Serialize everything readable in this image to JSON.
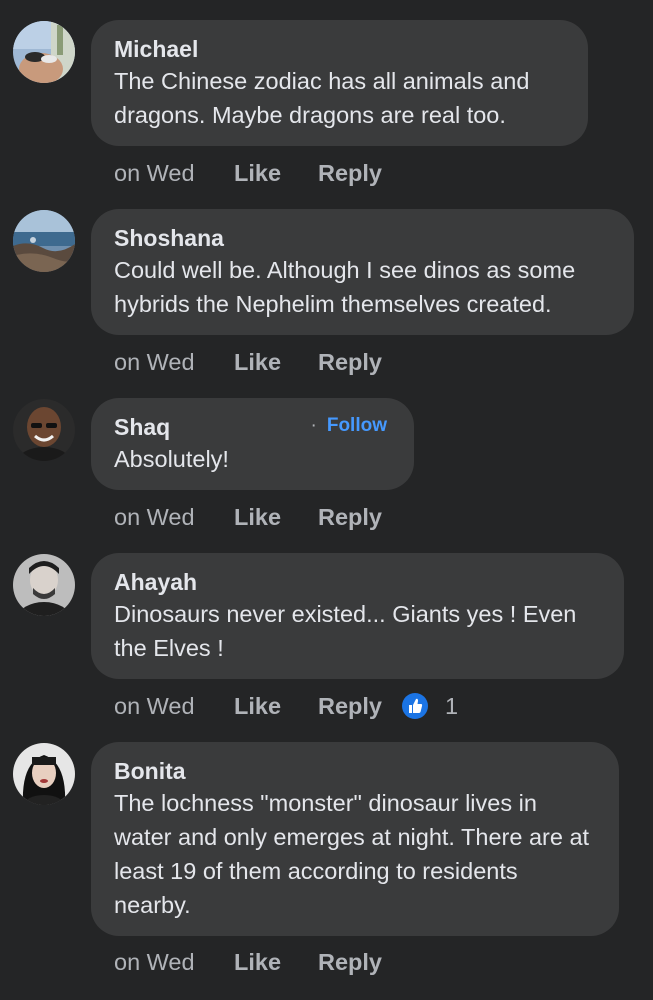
{
  "comments": [
    {
      "author": "Michael",
      "text": "The Chinese zodiac has all animals and dragons.  Maybe dragons are real too.",
      "time": "on Wed",
      "like_label": "Like",
      "reply_label": "Reply"
    },
    {
      "author": "Shoshana",
      "text": "Could well be. Although I see dinos as some hybrids the Nephelim themselves created.",
      "time": "on Wed",
      "like_label": "Like",
      "reply_label": "Reply"
    },
    {
      "author": "Shaq",
      "follow_label": "Follow",
      "text": "Absolutely!",
      "time": "on Wed",
      "like_label": "Like",
      "reply_label": "Reply"
    },
    {
      "author": "Ahayah",
      "text": "Dinosaurs never existed... Giants yes ! Even the Elves !",
      "time": "on Wed",
      "like_label": "Like",
      "reply_label": "Reply",
      "reaction_icon": "thumbs-up-icon",
      "reaction_count": "1"
    },
    {
      "author": "Bonita",
      "text": "The lochness \"monster\" dinosaur lives in water and only emerges at night. There are at least 19 of them according to residents nearby.",
      "time": "on Wed",
      "like_label": "Like",
      "reply_label": "Reply"
    }
  ],
  "colors": {
    "background": "#242526",
    "bubble": "#3a3b3c",
    "primary_text": "#e4e6eb",
    "secondary_text": "#b0b3b8",
    "follow_link": "#4599ff",
    "like_reaction": "#1b74e4"
  }
}
